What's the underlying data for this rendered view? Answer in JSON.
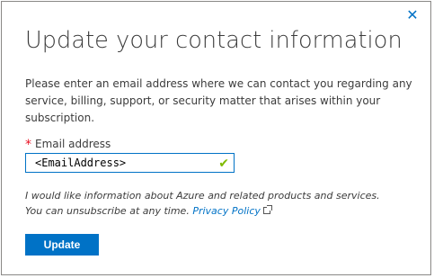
{
  "dialog": {
    "title": "Update your contact information",
    "close_icon": "close-icon",
    "description": "Please enter an email address where we can contact you regarding any service, billing, support, or security matter that arises within your subscription.",
    "email_field": {
      "required_marker": "*",
      "label": "Email address",
      "value": "<EmailAddress>",
      "valid_icon": "checkmark-icon"
    },
    "info": {
      "line1": "I would like information about Azure and related products and services.",
      "line2": "You can unsubscribe at any time.",
      "privacy_link": "Privacy Policy",
      "external_icon": "external-link-icon"
    },
    "update_button": "Update"
  },
  "colors": {
    "accent": "#0072c6",
    "required": "#e81123",
    "valid": "#7fba00",
    "text": "#3c3c3c"
  }
}
